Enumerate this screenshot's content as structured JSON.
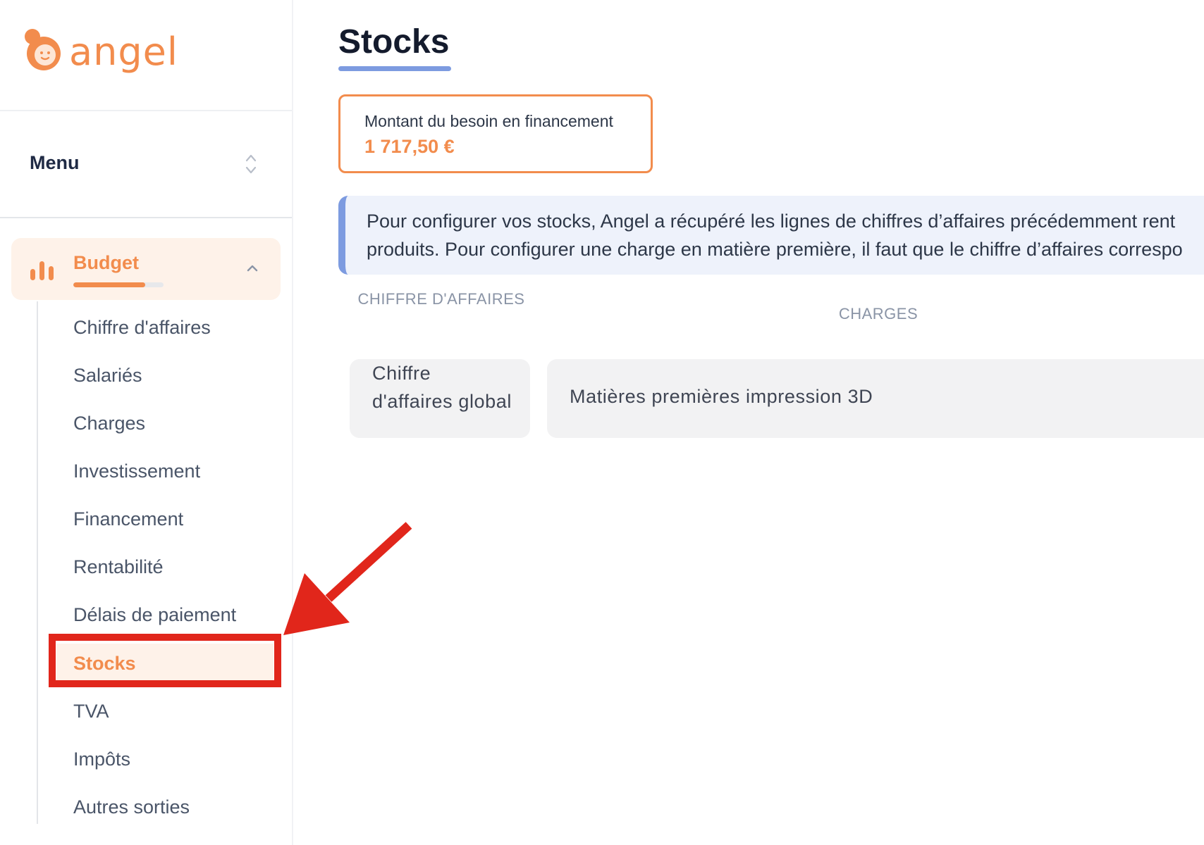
{
  "brand": {
    "name": "angel",
    "accent_color": "#f28c4d"
  },
  "sidebar": {
    "menu_label": "Menu",
    "budget": {
      "label": "Budget",
      "progress": 0.8
    },
    "items": [
      {
        "label": "Chiffre d'affaires",
        "active": false
      },
      {
        "label": "Salariés",
        "active": false
      },
      {
        "label": "Charges",
        "active": false
      },
      {
        "label": "Investissement",
        "active": false
      },
      {
        "label": "Financement",
        "active": false
      },
      {
        "label": "Rentabilité",
        "active": false
      },
      {
        "label": "Délais de paiement",
        "active": false
      },
      {
        "label": "Stocks",
        "active": true
      },
      {
        "label": "TVA",
        "active": false
      },
      {
        "label": "Impôts",
        "active": false
      },
      {
        "label": "Autres sorties",
        "active": false
      }
    ]
  },
  "main": {
    "title": "Stocks",
    "funding_card": {
      "label": "Montant du besoin en financement",
      "value": "1 717,50 €"
    },
    "info_banner": {
      "line1": "Pour configurer vos stocks, Angel a récupéré les lignes de chiffres d’affaires précédemment rent",
      "line2": "produits. Pour configurer une charge en matière première, il faut que le chiffre d’affaires correspo"
    },
    "table": {
      "headers": {
        "chiffre_affaires": "CHIFFRE D'AFFAIRES",
        "charges": "CHARGES"
      },
      "rows": [
        {
          "chiffre_affaires": "Chiffre d'affaires global",
          "charge": "Matières premières impression 3D"
        }
      ]
    }
  },
  "annotation": {
    "color": "#e1261b",
    "target": "Stocks"
  }
}
